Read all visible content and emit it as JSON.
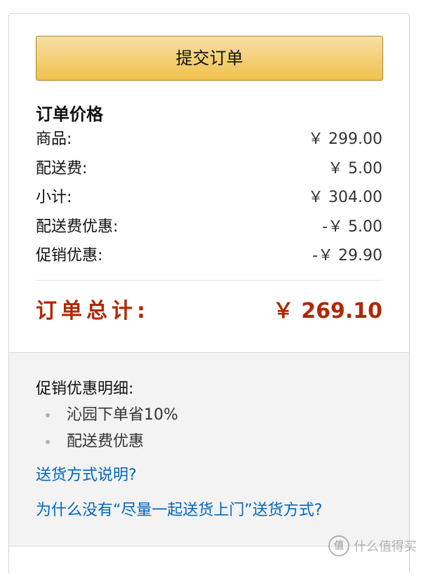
{
  "order": {
    "submit_label": "提交订单",
    "price_title": "订单价格",
    "lines": [
      {
        "label": "商品:",
        "amount": "￥ 299.00"
      },
      {
        "label": "配送费:",
        "amount": "￥ 5.00"
      },
      {
        "label": "小计:",
        "amount": "￥ 304.00"
      },
      {
        "label": "配送费优惠:",
        "amount": "-￥ 5.00"
      },
      {
        "label": "促销优惠:",
        "amount": "-￥ 29.90"
      }
    ],
    "total_label": "订单总计:",
    "total_amount": "￥ 269.10"
  },
  "promo": {
    "title": "促销优惠明细:",
    "items": [
      "沁园下单省10%",
      "配送费优惠"
    ]
  },
  "links": {
    "shipping_info": "送货方式说明?",
    "why_not_combined": "为什么没有“尽量一起送货上门”送货方式?"
  },
  "watermark": {
    "text": "什么值得买",
    "icon": "值"
  },
  "colors": {
    "accent_red": "#b12704",
    "link_blue": "#0066c0",
    "button_yellow": "#f0c14b"
  }
}
